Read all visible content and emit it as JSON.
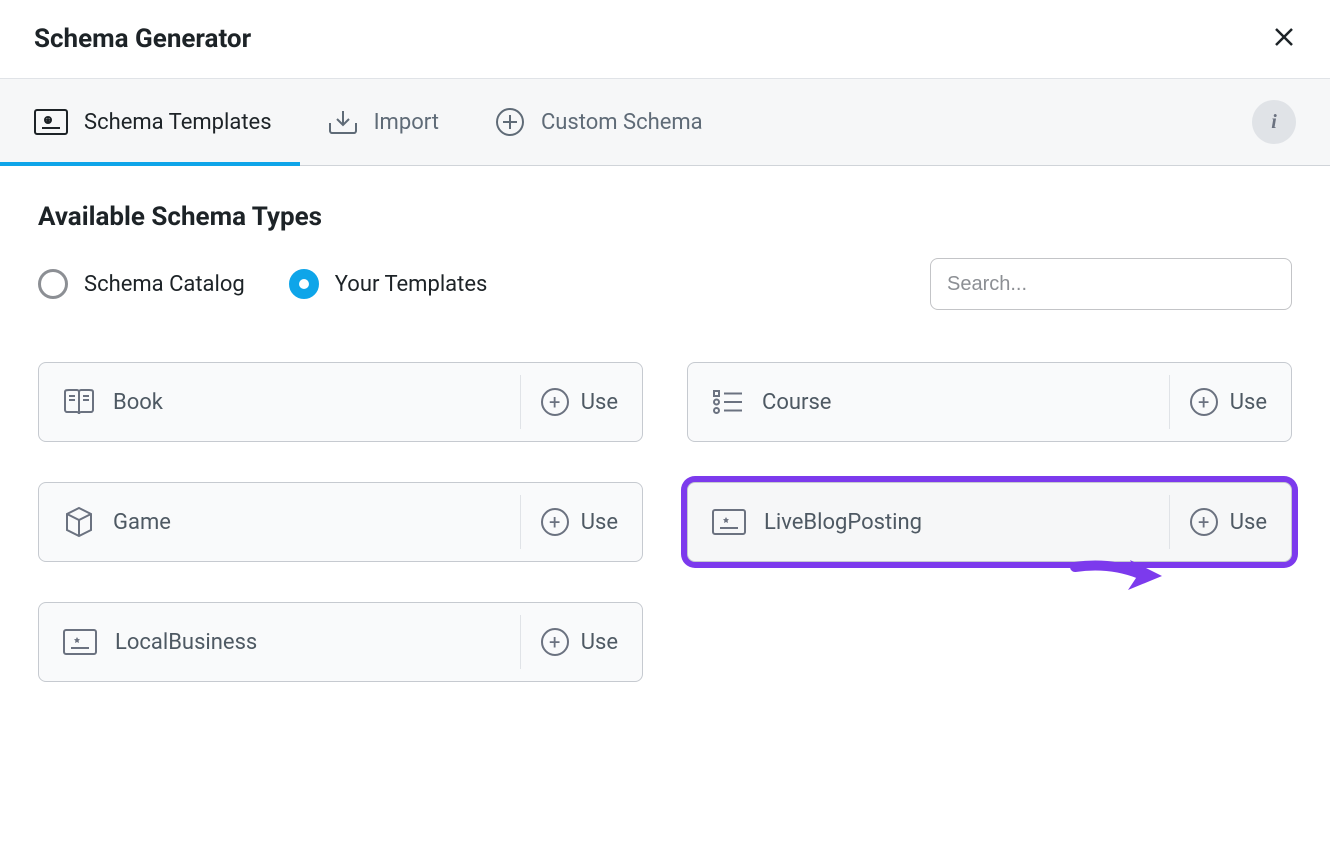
{
  "header": {
    "title": "Schema Generator"
  },
  "tabs": {
    "templates_label": "Schema Templates",
    "import_label": "Import",
    "custom_label": "Custom Schema"
  },
  "section": {
    "title": "Available Schema Types"
  },
  "filters": {
    "catalog_label": "Schema Catalog",
    "templates_label": "Your Templates"
  },
  "search": {
    "placeholder": "Search..."
  },
  "cards": {
    "use_label": "Use",
    "items": [
      {
        "label": "Book"
      },
      {
        "label": "Course"
      },
      {
        "label": "Game"
      },
      {
        "label": "LiveBlogPosting"
      },
      {
        "label": "LocalBusiness"
      }
    ]
  },
  "colors": {
    "accent": "#0ea5e9",
    "highlight": "#7c3aed"
  }
}
